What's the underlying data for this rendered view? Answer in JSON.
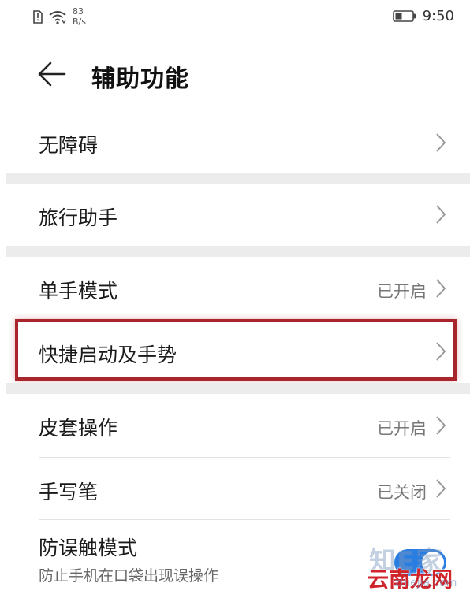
{
  "status_bar": {
    "speed_value": "83",
    "speed_unit": "B/s",
    "time": "9:50"
  },
  "header": {
    "title": "辅助功能"
  },
  "items": [
    {
      "label": "无障碍",
      "status": ""
    },
    {
      "label": "旅行助手",
      "status": ""
    },
    {
      "label": "单手模式",
      "status": "已开启"
    },
    {
      "label": "快捷启动及手势",
      "status": ""
    },
    {
      "label": "皮套操作",
      "status": "已开启"
    },
    {
      "label": "手写笔",
      "status": "已关闭"
    }
  ],
  "toggle_item": {
    "label": "防误触模式",
    "subtitle": "防止手机在口袋出现误操作",
    "enabled": true
  },
  "watermark": {
    "logo": "知E家",
    "text": "云南龙网",
    "url": "zhiejia.com"
  },
  "colors": {
    "highlight": "#a8262b",
    "toggle_on": "#2a7de1",
    "section_gap": "#ececec"
  }
}
